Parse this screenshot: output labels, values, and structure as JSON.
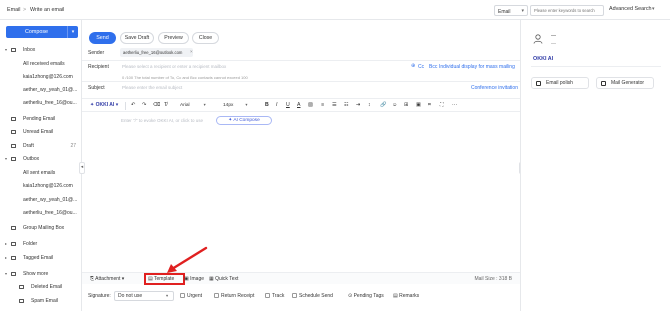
{
  "breadcrumb": {
    "root": "Email",
    "separator": ">",
    "current": "Write an email"
  },
  "search": {
    "type": "Email",
    "placeholder": "Please enter keywords to search",
    "advanced": "Advanced Search"
  },
  "sidebar": {
    "compose": "Compose",
    "items": [
      {
        "label": "Inbox",
        "count": ""
      },
      {
        "label": "All received emails",
        "count": ""
      },
      {
        "label": "kaia1zhong@126.com",
        "count": ""
      },
      {
        "label": "aether_wy_yeah_01@...",
        "count": ""
      },
      {
        "label": "aetherliu_free_16@ou...",
        "count": ""
      },
      {
        "label": "Pending Email",
        "count": ""
      },
      {
        "label": "Unread Email",
        "count": ""
      },
      {
        "label": "Draft",
        "count": "27"
      },
      {
        "label": "Outbox",
        "count": ""
      },
      {
        "label": "All sent emails",
        "count": ""
      },
      {
        "label": "kaia1zhong@126.com",
        "count": ""
      },
      {
        "label": "aether_wy_yeah_01@...",
        "count": ""
      },
      {
        "label": "aetherliu_free_16@ou...",
        "count": ""
      },
      {
        "label": "Group Mailing Box",
        "count": ""
      },
      {
        "label": "Folder",
        "count": ""
      },
      {
        "label": "Tagged Email",
        "count": ""
      },
      {
        "label": "Show more",
        "count": ""
      },
      {
        "label": "Deleted Email",
        "count": ""
      },
      {
        "label": "Spam Email",
        "count": ""
      }
    ]
  },
  "toolbar": {
    "send": "Send",
    "save_draft": "Save Draft",
    "preview": "Preview",
    "close": "Close"
  },
  "compose": {
    "sender_label": "Sender",
    "sender_value": "aetherliu_free_16@outlook.com",
    "recipient_label": "Recipient",
    "recipient_placeholder": "Please select a recipient or enter a recipient mailbox",
    "recipient_hint": "0 /100 The total number of To, Cc and Bcc contacts cannot exceed 100",
    "cc": "Cc",
    "bcc": "Bcc",
    "individual": "Individual display for mass mailing",
    "subject_label": "Subject",
    "subject_placeholder": "Please enter the email subject",
    "conference": "Conference invitation"
  },
  "editor": {
    "okki_ai": "OKKI AI",
    "font": "Arial",
    "size": "14px",
    "placeholder": "Enter \"/\" to evoke OKKI AI, or click to use",
    "ai_compose": "AI Compose"
  },
  "attachments": {
    "attachment": "Attachment",
    "template": "Template",
    "image": "Image",
    "quick_text": "Quick Text",
    "mail_size": "Mail Size : 318 B"
  },
  "options": {
    "signature_label": "Signature:",
    "signature_value": "Do not use",
    "urgent": "Urgent",
    "return_receipt": "Return Receipt",
    "track": "Track",
    "schedule_send": "Schedule Send",
    "pending_tags": "Pending Tags",
    "remarks": "Remarks"
  },
  "right_panel": {
    "name": "—",
    "sub": "—",
    "brand": "OKKI AI",
    "email_polish": "Email polish",
    "mail_generator": "Mail Generator"
  },
  "colors": {
    "accent": "#2f6fec",
    "highlight": "#e02020"
  }
}
